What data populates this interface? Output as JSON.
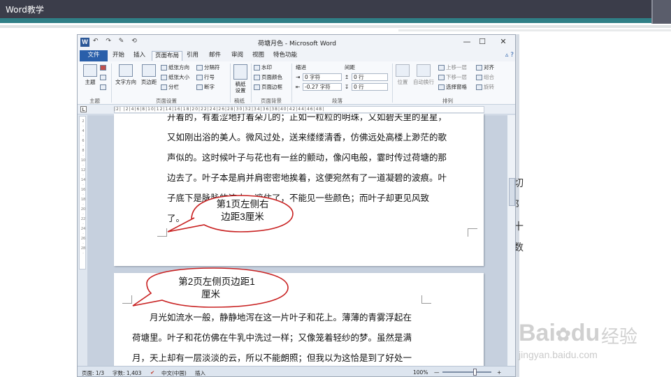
{
  "slide": {
    "title": "Word教学"
  },
  "window": {
    "logo": "W",
    "qat": "↶ ↷ ✎ ⟲",
    "title": "荷塘月色 - Microsoft Word",
    "minimize": "—",
    "maximize": "☐",
    "close": "✕"
  },
  "tabs": [
    "文件",
    "开始",
    "插入",
    "页面布局",
    "引用",
    "邮件",
    "审阅",
    "视图",
    "特色功能"
  ],
  "ribbon": {
    "themes": {
      "big": "主题",
      "group": "主题"
    },
    "page_setup": {
      "text_direction": "文字方向",
      "margins": "页边距",
      "orientation": "纸张方向",
      "size": "纸张大小",
      "columns": "分栏",
      "breaks": "分隔符",
      "line_numbers": "行号",
      "hyphenation": "断字",
      "group": "页面设置"
    },
    "manuscript": {
      "big": "稿纸设置",
      "group": "稿纸"
    },
    "page_background": {
      "watermark": "水印",
      "page_color": "页面颜色",
      "page_borders": "页面边框",
      "group": "页面背景"
    },
    "paragraph": {
      "indent_label": "缩进",
      "spacing_label": "间距",
      "indent_left": "0 字符",
      "indent_right": "-0.27 字符",
      "spacing_before": "0 行",
      "spacing_after": "0 行",
      "group": "段落"
    },
    "arrange": {
      "position": "位置",
      "wrap": "自动换行",
      "bring_forward": "上移一层",
      "send_backward": "下移一层",
      "selection_pane": "选择窗格",
      "align": "对齐",
      "group_btn": "组合",
      "rotate": "旋转",
      "group": "排列"
    }
  },
  "ruler": {
    "marks": "|2| |2|4|6|8|10|12|14|16|18|20|22|24|26|28|30|32|34|36|38|40|42|44|46|48|"
  },
  "document": {
    "page1_lines": [
      "开着的，有羞涩地打着朵儿的；正如一粒粒的明珠，又如碧天里的星星，",
      "又如刚出浴的美人。微风过处，送来缕缕清香，仿佛远处高楼上渺茫的歌",
      "声似的。这时候叶子与花也有一丝的颤动，像闪电般，霎时传过荷塘的那",
      "边去了。叶子本是肩并肩密密地挨着，这便宛然有了一道凝碧的波痕。叶",
      "子底下是脉脉的流水，遮住了，不能见一些颜色；而叶子却更见风致",
      "了。"
    ],
    "page2_lines": [
      "　　月光如流水一般，静静地泻在这一片叶子和花上。薄薄的青雾浮起在",
      "荷塘里。叶子和花仿佛在牛乳中洗过一样；又像笼着轻纱的梦。虽然是满",
      "月，天上却有一层淡淡的云，所以不能朗照；但我以为这恰是到了好处一"
    ]
  },
  "callouts": {
    "first": [
      "第1页左侧右",
      "边距3厘米"
    ],
    "second": [
      "第2页左侧页边距1",
      "厘米"
    ]
  },
  "status": {
    "page": "页面: 1/3",
    "words": "字数: 1,403",
    "language": "中文(中国)",
    "mode": "插入",
    "zoom": "100%",
    "zoom_minus": "—",
    "zoom_plus": "+"
  },
  "background_glyphs": [
    "切",
    "阝",
    "十",
    "数"
  ],
  "watermark": {
    "brand": "Bai",
    "brand2": "du",
    "jingyan": "经验",
    "url": "jingyan.baidu.com"
  }
}
